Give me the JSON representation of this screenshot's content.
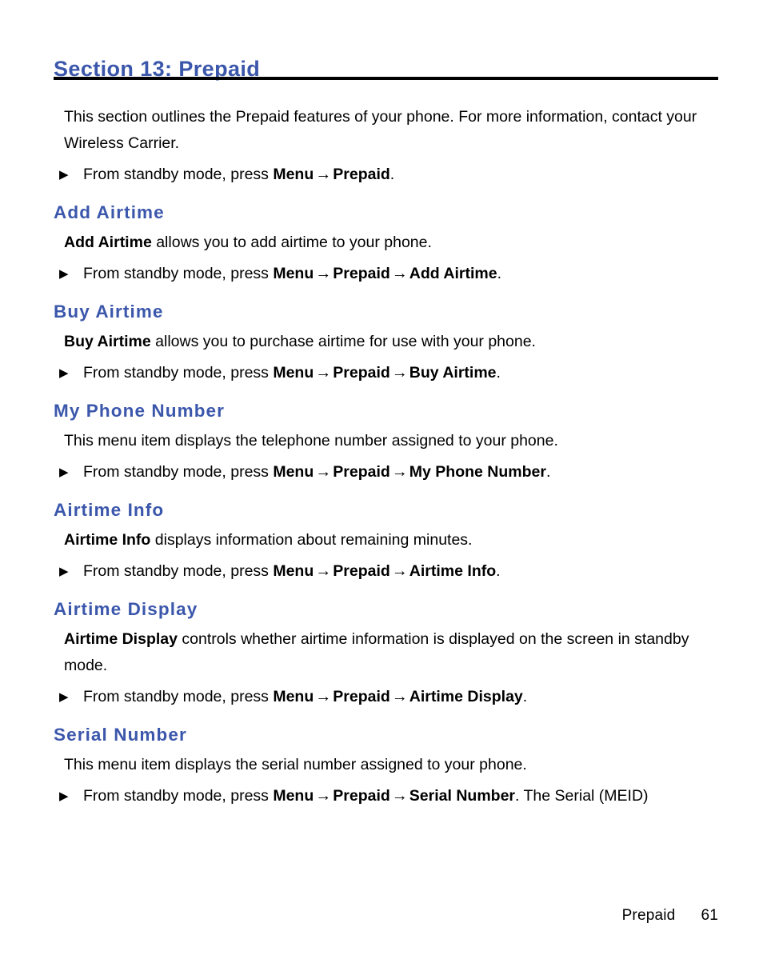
{
  "document": {
    "section_title": "Section 13: Prepaid",
    "intro": {
      "paragraph": "This section outlines the Prepaid features of your phone. For more information, contact your Wireless Carrier.",
      "bullet": {
        "lead": "From standby mode, press ",
        "path": [
          "Menu",
          "Prepaid"
        ],
        "tail": "."
      }
    },
    "sections": [
      {
        "heading": "Add Airtime",
        "body_bold_lead": "Add Airtime",
        "body_rest": " allows you to add airtime to your phone.",
        "bullet": {
          "lead": "From standby mode, press ",
          "path": [
            "Menu",
            "Prepaid",
            "Add Airtime"
          ],
          "tail": "."
        }
      },
      {
        "heading": "Buy Airtime",
        "body_bold_lead": "Buy Airtime",
        "body_rest": " allows you to purchase airtime for use with your phone.",
        "bullet": {
          "lead": "From standby mode, press ",
          "path": [
            "Menu",
            "Prepaid",
            "Buy Airtime"
          ],
          "tail": "."
        }
      },
      {
        "heading": "My Phone Number",
        "body_bold_lead": "",
        "body_rest": "This menu item displays the telephone number assigned to your phone.",
        "bullet": {
          "lead": "From standby mode, press ",
          "path": [
            "Menu",
            "Prepaid",
            "My Phone Number"
          ],
          "tail": "."
        }
      },
      {
        "heading": "Airtime Info",
        "body_bold_lead": "Airtime Info",
        "body_rest": " displays information about remaining minutes.",
        "bullet": {
          "lead": "From standby mode, press ",
          "path": [
            "Menu",
            "Prepaid",
            "Airtime Info"
          ],
          "tail": "."
        }
      },
      {
        "heading": "Airtime Display",
        "body_bold_lead": "Airtime Display",
        "body_rest": " controls whether airtime information is displayed on the screen in standby mode.",
        "bullet": {
          "lead": "From standby mode, press ",
          "path": [
            "Menu",
            "Prepaid",
            "Airtime Display"
          ],
          "tail": "."
        }
      },
      {
        "heading": "Serial Number",
        "body_bold_lead": "",
        "body_rest": "This menu item displays the serial number assigned to your phone.",
        "bullet": {
          "lead": "From standby mode, press ",
          "path": [
            "Menu",
            "Prepaid",
            "Serial Number"
          ],
          "tail": ". The Serial (MEID)"
        }
      }
    ],
    "footer": {
      "label": "Prepaid",
      "page_number": "61"
    },
    "glyphs": {
      "bullet": "▶",
      "arrow": "→"
    },
    "colors": {
      "heading_blue": "#3b57ab",
      "rule_black": "#000000",
      "body_black": "#000000",
      "page_background": "#ffffff"
    }
  }
}
